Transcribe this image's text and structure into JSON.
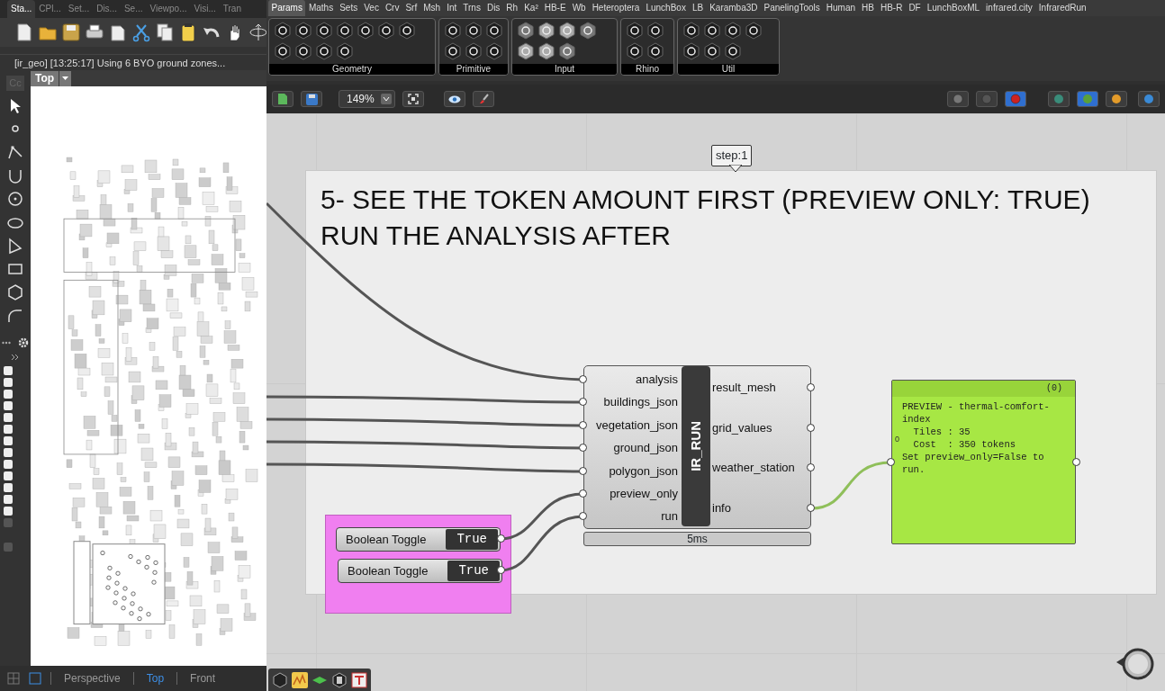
{
  "rhino": {
    "tabs": [
      {
        "label": "Sta...",
        "selected": true
      },
      {
        "label": "CPl...",
        "selected": false
      },
      {
        "label": "Set...",
        "selected": false
      },
      {
        "label": "Dis...",
        "selected": false
      },
      {
        "label": "Se...",
        "selected": false
      },
      {
        "label": "Viewpo...",
        "selected": false
      },
      {
        "label": "Visi...",
        "selected": false
      },
      {
        "label": "Tran",
        "selected": false
      }
    ],
    "command_line": "[ir_geo] [13:25:17] Using 6 BYO ground zones...",
    "command_field": "Cc",
    "layers": [
      {
        "checked": true
      },
      {
        "checked": true
      },
      {
        "checked": true
      },
      {
        "checked": true
      },
      {
        "checked": true
      },
      {
        "checked": true
      },
      {
        "checked": true
      },
      {
        "checked": true
      },
      {
        "checked": true
      },
      {
        "checked": true
      },
      {
        "checked": true
      },
      {
        "checked": true
      },
      {
        "checked": true
      },
      {
        "checked": false
      },
      {
        "checked": false
      }
    ],
    "viewport": {
      "label": "Top"
    },
    "view_tabs": [
      {
        "label": "Perspective",
        "selected": false
      },
      {
        "label": "Top",
        "selected": true
      },
      {
        "label": "Front",
        "selected": false
      }
    ]
  },
  "grasshopper": {
    "tabs": [
      {
        "label": "Params",
        "selected": true
      },
      {
        "label": "Maths",
        "selected": false
      },
      {
        "label": "Sets",
        "selected": false
      },
      {
        "label": "Vec",
        "selected": false
      },
      {
        "label": "Crv",
        "selected": false
      },
      {
        "label": "Srf",
        "selected": false
      },
      {
        "label": "Msh",
        "selected": false
      },
      {
        "label": "Int",
        "selected": false
      },
      {
        "label": "Trns",
        "selected": false
      },
      {
        "label": "Dis",
        "selected": false
      },
      {
        "label": "Rh",
        "selected": false
      },
      {
        "label": "Ka²",
        "selected": false
      },
      {
        "label": "HB-E",
        "selected": false
      },
      {
        "label": "Wb",
        "selected": false
      },
      {
        "label": "Heteroptera",
        "selected": false
      },
      {
        "label": "LunchBox",
        "selected": false
      },
      {
        "label": "LB",
        "selected": false
      },
      {
        "label": "Karamba3D",
        "selected": false
      },
      {
        "label": "PanelingTools",
        "selected": false
      },
      {
        "label": "Human",
        "selected": false
      },
      {
        "label": "HB",
        "selected": false
      },
      {
        "label": "HB-R",
        "selected": false
      },
      {
        "label": "DF",
        "selected": false
      },
      {
        "label": "LunchBoxML",
        "selected": false
      },
      {
        "label": "infrared.city",
        "selected": false
      },
      {
        "label": "InfraredRun",
        "selected": false
      }
    ],
    "ribbon_groups": [
      {
        "label": "Geometry"
      },
      {
        "label": "Primitive"
      },
      {
        "label": "Input"
      },
      {
        "label": "Rhino"
      },
      {
        "label": "Util"
      }
    ],
    "zoom": "149%",
    "canvas": {
      "balloon": "step:1",
      "group_title": "5- SEE THE TOKEN AMOUNT FIRST (PREVIEW ONLY: TRUE)\nRUN THE ANALYSIS AFTER",
      "component": {
        "name": "IR_RUN",
        "inputs": [
          "analysis",
          "buildings_json",
          "vegetation_json",
          "ground_json",
          "polygon_json",
          "preview_only",
          "run"
        ],
        "outputs": [
          "result_mesh",
          "grid_values",
          "weather_station",
          "info"
        ],
        "time": "5ms"
      },
      "toggles": [
        {
          "label": "Boolean Toggle",
          "value": "True"
        },
        {
          "label": "Boolean Toggle",
          "value": "True"
        }
      ],
      "panel": {
        "header": "(0)",
        "index": "0",
        "text": "PREVIEW - thermal-comfort-index\n  Tiles : 35\n  Cost  : 350 tokens\nSet preview_only=False to run."
      }
    }
  }
}
